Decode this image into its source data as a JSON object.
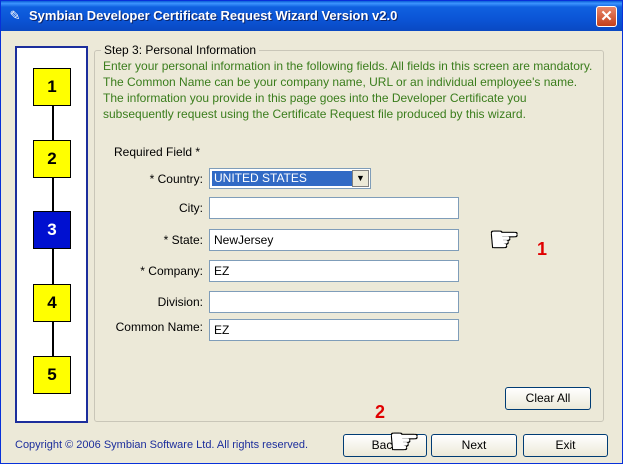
{
  "window": {
    "title": "Symbian Developer Certificate Request Wizard Version v2.0",
    "close_glyph": "✕"
  },
  "steps": [
    {
      "number": "1",
      "active": false
    },
    {
      "number": "2",
      "active": false
    },
    {
      "number": "3",
      "active": true
    },
    {
      "number": "4",
      "active": false
    },
    {
      "number": "5",
      "active": false
    }
  ],
  "step3": {
    "group_title": "Step 3: Personal Information",
    "description": "Enter your personal information in the following fields. All fields in this screen are mandatory. The Common Name can be your company name, URL or an individual employee's name. The information you provide in this page goes into the Developer Certificate you subsequently request using the Certificate Request file produced by this wizard.",
    "required_note": "Required Field *"
  },
  "form": {
    "country_label": "* Country:",
    "country_value": "UNITED STATES",
    "city_label": "City:",
    "city_value": "",
    "state_label": "* State:",
    "state_value": "NewJersey",
    "company_label": "* Company:",
    "company_value": "EZ",
    "division_label": "Division:",
    "division_value": "",
    "common_name_label": "Common Name:",
    "common_name_value": "EZ"
  },
  "buttons": {
    "clear_all": "Clear All",
    "back": "Back",
    "next": "Next",
    "exit": "Exit"
  },
  "footer": {
    "copyright": "Copyright © 2006 Symbian Software Ltd. All rights reserved."
  },
  "annotations": {
    "marker_1": "1",
    "marker_2": "2",
    "accent_color": "#e00000"
  }
}
